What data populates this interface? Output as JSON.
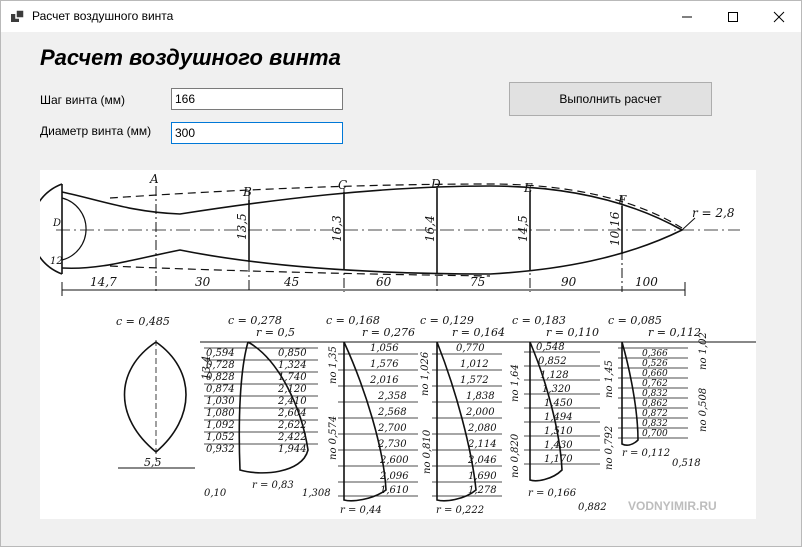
{
  "window": {
    "title": "Расчет воздушного винта",
    "controls": {
      "minimize": "—",
      "maximize": "☐",
      "close": "✕"
    }
  },
  "form": {
    "heading": "Расчет воздушного винта",
    "pitch_label": "Шаг винта (мм)",
    "pitch_value": "166",
    "diameter_label": "Диаметр винта (мм)",
    "diameter_value": "300",
    "calculate_button": "Выполнить расчет"
  },
  "drawing": {
    "stations": [
      "A",
      "B",
      "C",
      "D",
      "E",
      "F"
    ],
    "tip_radius": "r = 2,8",
    "thickness": [
      "13,5",
      "16,3",
      "16,4",
      "14,5",
      "10,16"
    ],
    "spacings": [
      "14,7",
      "30",
      "45",
      "60",
      "75",
      "90",
      "100"
    ],
    "hub_d": "D",
    "hub_12": "12",
    "chords": [
      "c = 0,485",
      "c = 0,278",
      "c = 0,168",
      "c = 0,129",
      "c = 0,183",
      "c = 0,085"
    ],
    "radii": [
      "r = 0,5",
      "r = 0,276",
      "r = 0,164",
      "r = 0,110",
      "r = 0,112"
    ],
    "section_a": {
      "width": "5,5",
      "height": "13,4"
    },
    "section_b": {
      "left": [
        "0,594",
        "0,728",
        "0,828",
        "0,874",
        "1,030",
        "1,080",
        "1,092",
        "1,052",
        "0,932"
      ],
      "right": [
        "0,850",
        "1,324",
        "1,740",
        "2,120",
        "2,410",
        "2,604",
        "2,622",
        "2,422",
        "1,944"
      ],
      "bottom_left": "0,10",
      "bottom_r": "r = 0,83",
      "bottom_right": "1,308"
    },
    "section_c": {
      "values": [
        "1,056",
        "1,576",
        "2,016",
        "2,358",
        "2,568",
        "2,700",
        "2,730",
        "2,600",
        "2,096",
        "1,610"
      ],
      "side_top": "по 1,35",
      "side_bottom": "по 0,574",
      "bottom_r": "r = 0,44"
    },
    "section_d": {
      "values": [
        "0,770",
        "1,012",
        "1,572",
        "1,838",
        "2,000",
        "2,080",
        "2,114",
        "2,046",
        "1,690",
        "1,278"
      ],
      "side_top": "по 1,026",
      "side_bottom": "по 0,810",
      "bottom_r": "r = 0,222"
    },
    "section_e": {
      "values": [
        "0,548",
        "0,852",
        "1,128",
        "1,320",
        "1,450",
        "1,494",
        "1,510",
        "1,430",
        "1,170"
      ],
      "side_top": "по 1,64",
      "side_bottom": "по 0,820",
      "bottom_r": "r = 0,166",
      "bottom_right": "0,882"
    },
    "section_f": {
      "values": [
        "0,366",
        "0,526",
        "0,660",
        "0,762",
        "0,832",
        "0,862",
        "0,872",
        "0,832",
        "0,700"
      ],
      "side_top": "по 1,45",
      "side_bottom": "по 0,792",
      "bottom_r": "r = 0,112",
      "bottom_right": "0,518",
      "far_top": "по 1,02",
      "far_bottom": "по 0,508"
    },
    "watermark": "VODNYIMIR.RU"
  }
}
